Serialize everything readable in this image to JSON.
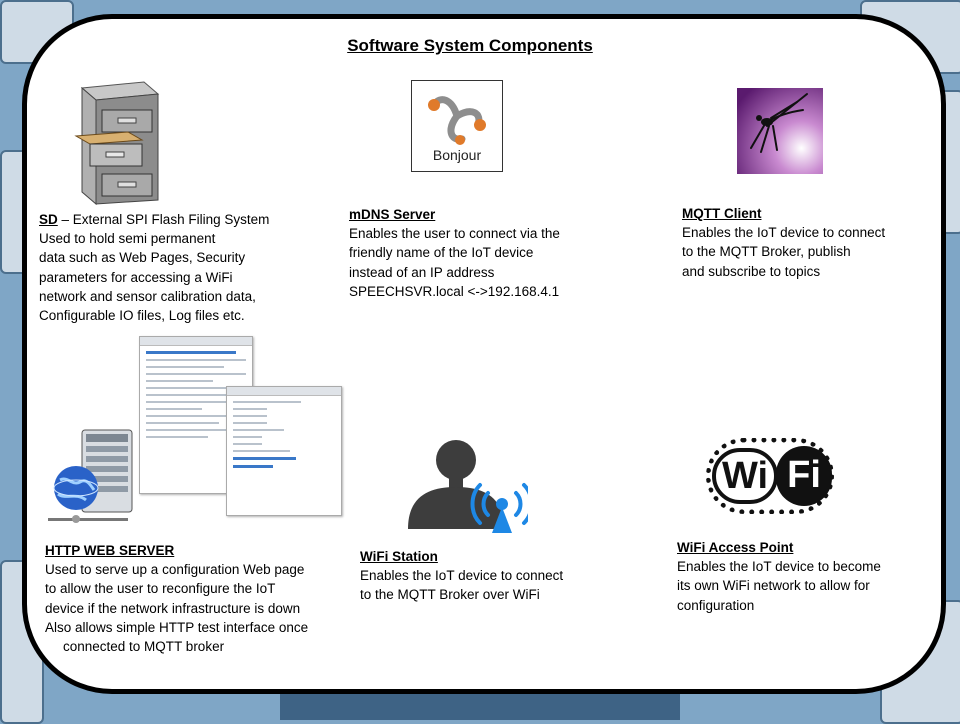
{
  "title": "Software System Components",
  "components": {
    "sd": {
      "heading": "SD",
      "heading_rest": " – External SPI Flash Filing System",
      "lines": [
        "Used to hold semi permanent",
        "data such as Web Pages, Security",
        "parameters for accessing a WiFi",
        "network  and sensor calibration data,",
        "Configurable IO files, Log files etc."
      ],
      "icon": "filing-cabinet-icon"
    },
    "mdns": {
      "heading": "mDNS Server",
      "lines": [
        "Enables the user to connect via the",
        "friendly name of the IoT device",
        "instead of an IP address",
        "SPEECHSVR.local <->192.168.4.1"
      ],
      "icon": "bonjour-logo",
      "logo_text": "Bonjour"
    },
    "mqtt": {
      "heading": "MQTT Client",
      "lines": [
        "Enables the IoT device to connect",
        "to the MQTT Broker, publish",
        "and subscribe to topics"
      ],
      "icon": "mosquitto-logo"
    },
    "http": {
      "heading": "HTTP WEB SERVER",
      "lines": [
        "Used to serve up a configuration Web page",
        "to allow the user to reconfigure the IoT",
        "device if the network infrastructure is down",
        "Also allows simple HTTP test interface once"
      ],
      "indent_line": "connected to MQTT broker",
      "icon": "web-server-icon"
    },
    "station": {
      "heading": "WiFi Station",
      "lines": [
        "Enables the IoT device to connect",
        "to the MQTT Broker over WiFi"
      ],
      "icon": "user-antenna-icon"
    },
    "ap": {
      "heading": "WiFi Access Point",
      "lines": [
        "Enables the IoT device to become",
        "its own WiFi network  to allow for",
        "configuration"
      ],
      "icon": "wifi-logo",
      "logo_left": "Wi",
      "logo_right": "Fi"
    }
  }
}
